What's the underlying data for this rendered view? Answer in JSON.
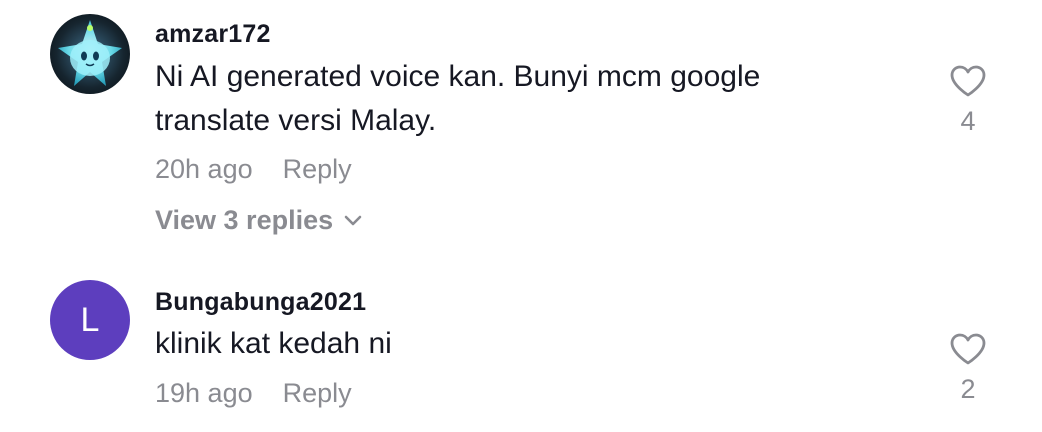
{
  "comments": [
    {
      "username": "amzar172",
      "text_line1": "Ni AI generated voice kan. Bunyi mcm google",
      "text_line2": "translate versi Malay.",
      "time": "20h ago",
      "reply_label": "Reply",
      "likes": "4",
      "view_replies": "View 3 replies"
    },
    {
      "username": "Bungabunga2021",
      "avatar_letter": "L",
      "text_line1": "klinik kat kedah ni",
      "time": "19h ago",
      "reply_label": "Reply",
      "likes": "2"
    }
  ],
  "colors": {
    "text": "#161823",
    "muted": "#8a8b91",
    "avatar_purple": "#5d3ebe"
  },
  "icons": {
    "like": "heart-outline-icon",
    "expand": "chevron-down-icon"
  }
}
